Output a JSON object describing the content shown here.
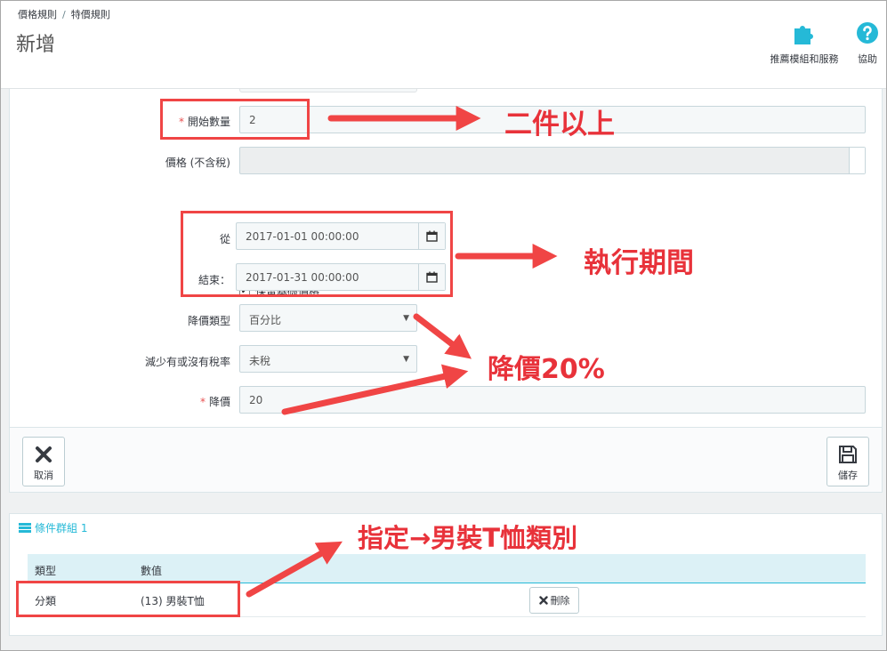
{
  "breadcrumb": {
    "parent": "價格規則",
    "separator": "/",
    "current": "特價規則"
  },
  "page_title": "新增",
  "toolbar": {
    "modules_label": "推薦模組和服務",
    "help_label": "協助"
  },
  "form": {
    "start_qty": {
      "label": "開始數量",
      "value": "2"
    },
    "price": {
      "label": "價格 (不含稅)",
      "value": ""
    },
    "keep_base_price": {
      "label": "保留基礎價格",
      "checked": true
    },
    "from": {
      "label": "從",
      "value": "2017-01-01 00:00:00"
    },
    "to": {
      "label": "結束：",
      "value": "2017-01-31 00:00:00"
    },
    "reduction_type": {
      "label": "降價類型",
      "value": "百分比"
    },
    "reduction_tax": {
      "label": "減少有或沒有稅率",
      "value": "未稅"
    },
    "reduction": {
      "label": "降價",
      "value": "20"
    }
  },
  "footer": {
    "cancel_label": "取消",
    "save_label": "儲存"
  },
  "conditions": {
    "title": "條件群組 1",
    "headers": [
      "類型",
      "數值"
    ],
    "rows": [
      {
        "type": "分類",
        "value": "(13) 男裝T恤",
        "delete_label": "刪除"
      }
    ]
  },
  "annotations": {
    "qty_note": "二件以上",
    "period_note": "執行期間",
    "discount_note": "降價20%",
    "category_note": "指定→男裝T恤類別"
  },
  "colors": {
    "accent": "#25b9d7",
    "annotation": "#e8323a",
    "required": "#e84f4f"
  }
}
